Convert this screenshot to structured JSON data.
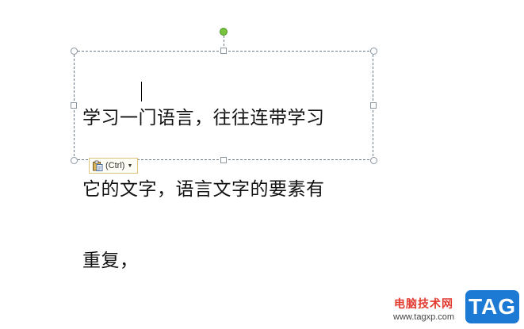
{
  "textbox": {
    "lines": [
      "学习一门语言，往往连带学习",
      "它的文字，语言文字的要素有",
      "重复，"
    ]
  },
  "paste_options": {
    "label": "(Ctrl)"
  },
  "watermark": {
    "site_name": "电脑技术网",
    "url": "www.tagxp.com",
    "badge": "TAG"
  },
  "colors": {
    "rotate_handle": "#79c23f",
    "frame": "#6b7d8c",
    "watermark_red": "#e23a2f",
    "badge_blue": "#1d7ad4"
  },
  "icons": {
    "paste": "clipboard-paste-icon",
    "dropdown": "dropdown-arrow-icon"
  }
}
